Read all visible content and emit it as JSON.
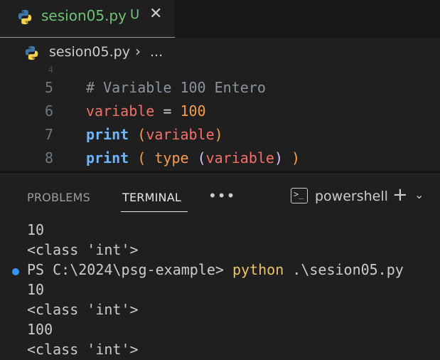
{
  "tab": {
    "filename": "sesion05.py",
    "status": "U",
    "close_glyph": "✕"
  },
  "breadcrumb": {
    "file": "sesion05.py",
    "separator": "›",
    "more": "..."
  },
  "editor": {
    "partial_line": "4",
    "lines": [
      {
        "number": "5",
        "tokens": [
          {
            "text": "# Variable 100 Entero",
            "kind": "comment"
          }
        ]
      },
      {
        "number": "6",
        "tokens": [
          {
            "text": "variable",
            "kind": "var"
          },
          {
            "text": " = ",
            "kind": "plain"
          },
          {
            "text": "100",
            "kind": "num"
          }
        ]
      },
      {
        "number": "7",
        "tokens": [
          {
            "text": "print",
            "kind": "kw"
          },
          {
            "text": " ",
            "kind": "plain"
          },
          {
            "text": "(",
            "kind": "bracket1"
          },
          {
            "text": "variable",
            "kind": "var"
          },
          {
            "text": ")",
            "kind": "bracket1"
          }
        ]
      },
      {
        "number": "8",
        "tokens": [
          {
            "text": "print",
            "kind": "kw"
          },
          {
            "text": " ",
            "kind": "plain"
          },
          {
            "text": "(",
            "kind": "bracket1"
          },
          {
            "text": " ",
            "kind": "plain"
          },
          {
            "text": "type",
            "kind": "type"
          },
          {
            "text": " ",
            "kind": "plain"
          },
          {
            "text": "(",
            "kind": "bracket2"
          },
          {
            "text": "variable",
            "kind": "var"
          },
          {
            "text": ")",
            "kind": "bracket2"
          },
          {
            "text": " ",
            "kind": "plain"
          },
          {
            "text": ")",
            "kind": "bracket1"
          }
        ]
      }
    ]
  },
  "panel": {
    "tabs": [
      "PROBLEMS",
      "TERMINAL"
    ],
    "active_tab": "TERMINAL",
    "more_glyph": "•••",
    "shell_name": "powershell",
    "new_terminal_glyph": "+",
    "dropdown_glyph": "⌄"
  },
  "terminal": {
    "line1": "10",
    "line2": "<class 'int'>",
    "prompt": "PS C:\\2024\\psg-example> ",
    "command": "python",
    "command_arg": " .\\sesion05.py",
    "line4": "10",
    "line5": "<class 'int'>",
    "line6": "100",
    "line7": "<class 'int'>"
  },
  "colors": {
    "accent_modified": "#6fc276",
    "keyword": "#6cb6ff",
    "variable": "#f47067",
    "number": "#f69d50",
    "comment": "#8b949e",
    "command": "#e8c46a",
    "decoration_dot": "#3794ff"
  },
  "icons": {
    "file": "python-file-icon",
    "terminal": "terminal-icon"
  }
}
